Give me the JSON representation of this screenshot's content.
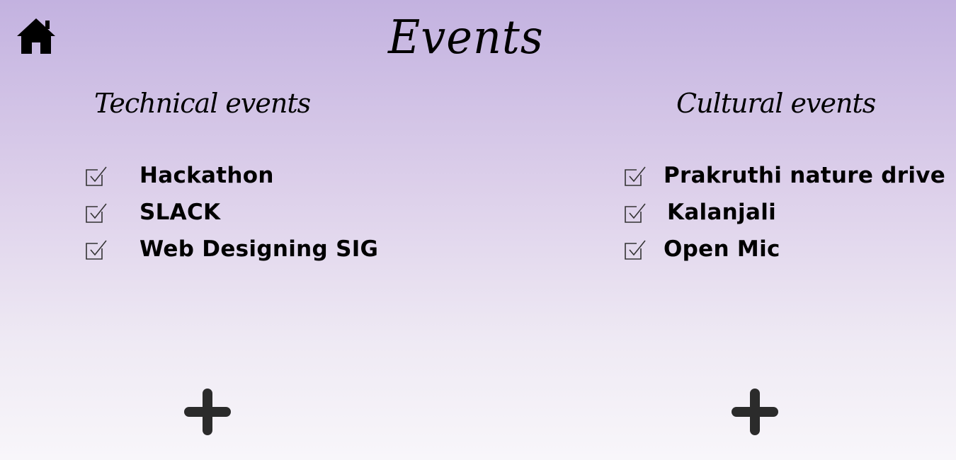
{
  "page": {
    "title": "Events"
  },
  "icons": {
    "home": "home-icon",
    "check": "checkbox-checked-icon",
    "add": "plus-icon"
  },
  "colors": {
    "background_top": "#c3b2e0",
    "background_bottom": "#f8f6fa",
    "icon": "#000000",
    "plus": "#2b2b2b"
  },
  "technical": {
    "heading": "Technical events",
    "items": [
      {
        "label": "Hackathon"
      },
      {
        "label": "SLACK"
      },
      {
        "label": "Web Designing SIG"
      }
    ]
  },
  "cultural": {
    "heading": "Cultural events",
    "items": [
      {
        "label": "Prakruthi nature drive"
      },
      {
        "label": "Kalanjali"
      },
      {
        "label": "Open Mic"
      }
    ]
  }
}
